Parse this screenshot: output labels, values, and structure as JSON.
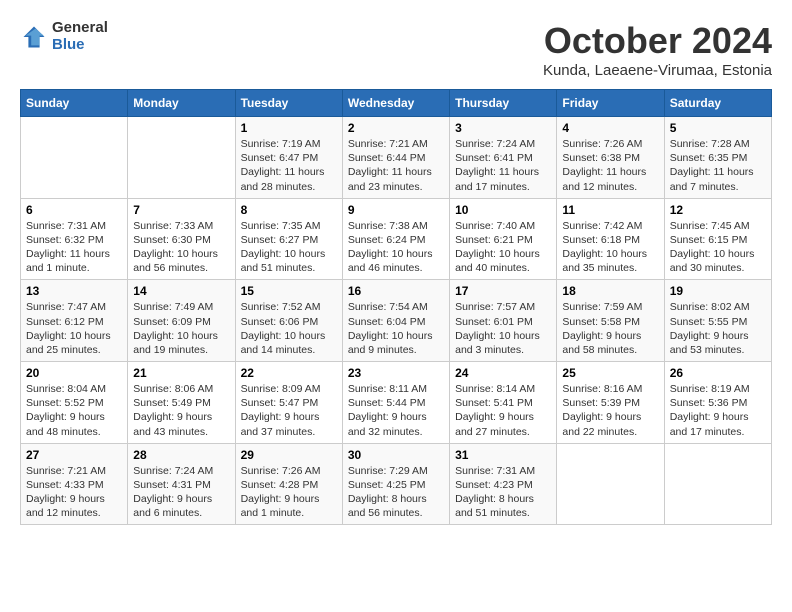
{
  "header": {
    "logo_general": "General",
    "logo_blue": "Blue",
    "month_title": "October 2024",
    "location": "Kunda, Laeaene-Virumaa, Estonia"
  },
  "days_of_week": [
    "Sunday",
    "Monday",
    "Tuesday",
    "Wednesday",
    "Thursday",
    "Friday",
    "Saturday"
  ],
  "weeks": [
    [
      {
        "day": "",
        "info": ""
      },
      {
        "day": "",
        "info": ""
      },
      {
        "day": "1",
        "info": "Sunrise: 7:19 AM\nSunset: 6:47 PM\nDaylight: 11 hours and 28 minutes."
      },
      {
        "day": "2",
        "info": "Sunrise: 7:21 AM\nSunset: 6:44 PM\nDaylight: 11 hours and 23 minutes."
      },
      {
        "day": "3",
        "info": "Sunrise: 7:24 AM\nSunset: 6:41 PM\nDaylight: 11 hours and 17 minutes."
      },
      {
        "day": "4",
        "info": "Sunrise: 7:26 AM\nSunset: 6:38 PM\nDaylight: 11 hours and 12 minutes."
      },
      {
        "day": "5",
        "info": "Sunrise: 7:28 AM\nSunset: 6:35 PM\nDaylight: 11 hours and 7 minutes."
      }
    ],
    [
      {
        "day": "6",
        "info": "Sunrise: 7:31 AM\nSunset: 6:32 PM\nDaylight: 11 hours and 1 minute."
      },
      {
        "day": "7",
        "info": "Sunrise: 7:33 AM\nSunset: 6:30 PM\nDaylight: 10 hours and 56 minutes."
      },
      {
        "day": "8",
        "info": "Sunrise: 7:35 AM\nSunset: 6:27 PM\nDaylight: 10 hours and 51 minutes."
      },
      {
        "day": "9",
        "info": "Sunrise: 7:38 AM\nSunset: 6:24 PM\nDaylight: 10 hours and 46 minutes."
      },
      {
        "day": "10",
        "info": "Sunrise: 7:40 AM\nSunset: 6:21 PM\nDaylight: 10 hours and 40 minutes."
      },
      {
        "day": "11",
        "info": "Sunrise: 7:42 AM\nSunset: 6:18 PM\nDaylight: 10 hours and 35 minutes."
      },
      {
        "day": "12",
        "info": "Sunrise: 7:45 AM\nSunset: 6:15 PM\nDaylight: 10 hours and 30 minutes."
      }
    ],
    [
      {
        "day": "13",
        "info": "Sunrise: 7:47 AM\nSunset: 6:12 PM\nDaylight: 10 hours and 25 minutes."
      },
      {
        "day": "14",
        "info": "Sunrise: 7:49 AM\nSunset: 6:09 PM\nDaylight: 10 hours and 19 minutes."
      },
      {
        "day": "15",
        "info": "Sunrise: 7:52 AM\nSunset: 6:06 PM\nDaylight: 10 hours and 14 minutes."
      },
      {
        "day": "16",
        "info": "Sunrise: 7:54 AM\nSunset: 6:04 PM\nDaylight: 10 hours and 9 minutes."
      },
      {
        "day": "17",
        "info": "Sunrise: 7:57 AM\nSunset: 6:01 PM\nDaylight: 10 hours and 3 minutes."
      },
      {
        "day": "18",
        "info": "Sunrise: 7:59 AM\nSunset: 5:58 PM\nDaylight: 9 hours and 58 minutes."
      },
      {
        "day": "19",
        "info": "Sunrise: 8:02 AM\nSunset: 5:55 PM\nDaylight: 9 hours and 53 minutes."
      }
    ],
    [
      {
        "day": "20",
        "info": "Sunrise: 8:04 AM\nSunset: 5:52 PM\nDaylight: 9 hours and 48 minutes."
      },
      {
        "day": "21",
        "info": "Sunrise: 8:06 AM\nSunset: 5:49 PM\nDaylight: 9 hours and 43 minutes."
      },
      {
        "day": "22",
        "info": "Sunrise: 8:09 AM\nSunset: 5:47 PM\nDaylight: 9 hours and 37 minutes."
      },
      {
        "day": "23",
        "info": "Sunrise: 8:11 AM\nSunset: 5:44 PM\nDaylight: 9 hours and 32 minutes."
      },
      {
        "day": "24",
        "info": "Sunrise: 8:14 AM\nSunset: 5:41 PM\nDaylight: 9 hours and 27 minutes."
      },
      {
        "day": "25",
        "info": "Sunrise: 8:16 AM\nSunset: 5:39 PM\nDaylight: 9 hours and 22 minutes."
      },
      {
        "day": "26",
        "info": "Sunrise: 8:19 AM\nSunset: 5:36 PM\nDaylight: 9 hours and 17 minutes."
      }
    ],
    [
      {
        "day": "27",
        "info": "Sunrise: 7:21 AM\nSunset: 4:33 PM\nDaylight: 9 hours and 12 minutes."
      },
      {
        "day": "28",
        "info": "Sunrise: 7:24 AM\nSunset: 4:31 PM\nDaylight: 9 hours and 6 minutes."
      },
      {
        "day": "29",
        "info": "Sunrise: 7:26 AM\nSunset: 4:28 PM\nDaylight: 9 hours and 1 minute."
      },
      {
        "day": "30",
        "info": "Sunrise: 7:29 AM\nSunset: 4:25 PM\nDaylight: 8 hours and 56 minutes."
      },
      {
        "day": "31",
        "info": "Sunrise: 7:31 AM\nSunset: 4:23 PM\nDaylight: 8 hours and 51 minutes."
      },
      {
        "day": "",
        "info": ""
      },
      {
        "day": "",
        "info": ""
      }
    ]
  ]
}
